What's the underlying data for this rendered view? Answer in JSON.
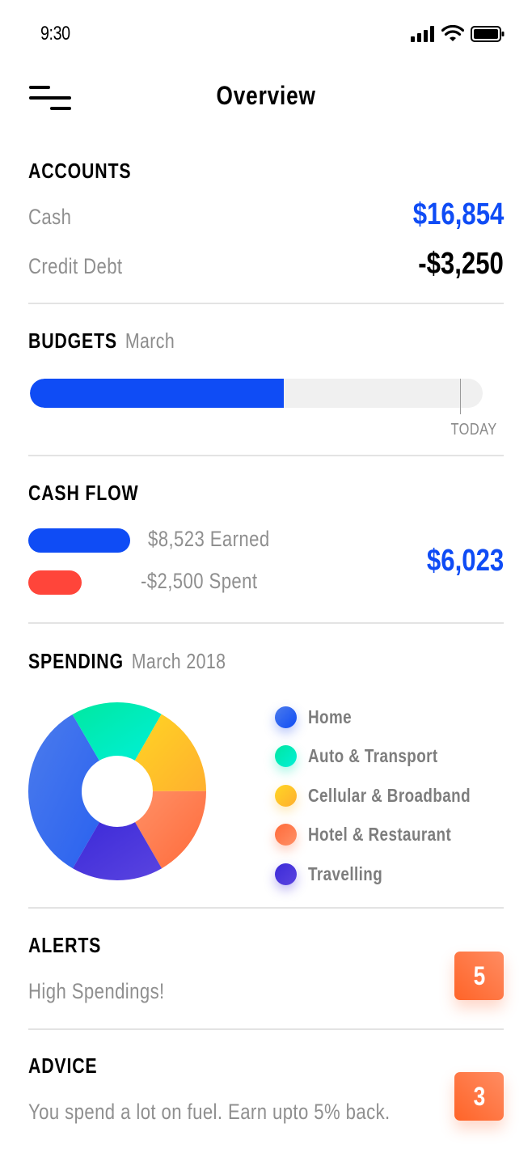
{
  "status_bar": {
    "time": "9:30",
    "icons": [
      "signal-icon",
      "wifi-icon",
      "battery-icon"
    ]
  },
  "header": {
    "menu_icon": "menu-icon",
    "title": "Overview"
  },
  "colors": {
    "accent_blue": "#0f4cf5",
    "spent_red": "#ff453a",
    "badge_orange": "#ff6a33",
    "muted_text": "#8f8f8f"
  },
  "accounts": {
    "title": "ACCOUNTS",
    "rows": [
      {
        "label": "Cash",
        "value": "$16,854"
      },
      {
        "label": "Credit Debt",
        "value": "-$3,250"
      }
    ]
  },
  "budgets": {
    "title": "BUDGETS",
    "period": "March",
    "progress_percent": 56,
    "today_percent": 95,
    "today_label": "TODAY"
  },
  "cash_flow": {
    "title": "CASH FLOW",
    "earned_label": "$8,523 Earned",
    "spent_label": "-$2,500 Spent",
    "net": "$6,023"
  },
  "spending": {
    "title": "SPENDING",
    "period": "March 2018",
    "categories": [
      {
        "label": "Home",
        "icon": "legend-dot-home"
      },
      {
        "label": "Auto & Transport",
        "icon": "legend-dot-auto"
      },
      {
        "label": "Cellular & Broadband",
        "icon": "legend-dot-cellular"
      },
      {
        "label": "Hotel & Restaurant",
        "icon": "legend-dot-hotel"
      },
      {
        "label": "Travelling",
        "icon": "legend-dot-travel"
      }
    ]
  },
  "chart_data": {
    "type": "pie",
    "title": "SPENDING March 2018",
    "donut": true,
    "legend_position": "right",
    "categories": [
      "Home",
      "Auto & Transport",
      "Cellular & Broadband",
      "Hotel & Restaurant",
      "Travelling"
    ],
    "values": [
      33.3,
      16.7,
      16.7,
      16.7,
      16.7
    ],
    "colors": [
      [
        "#4b7bec",
        "#2a62f0"
      ],
      [
        "#00e8a0",
        "#00f0d8"
      ],
      [
        "#ffd424",
        "#ffb02e"
      ],
      [
        "#ff9066",
        "#ff6a3a"
      ],
      [
        "#3c2ad8",
        "#5a44e0"
      ]
    ]
  },
  "alerts": {
    "title": "ALERTS",
    "message": "High Spendings!",
    "count": "5"
  },
  "advice": {
    "title": "ADVICE",
    "message": "You spend a lot on fuel. Earn upto 5% back.",
    "count": "3"
  }
}
